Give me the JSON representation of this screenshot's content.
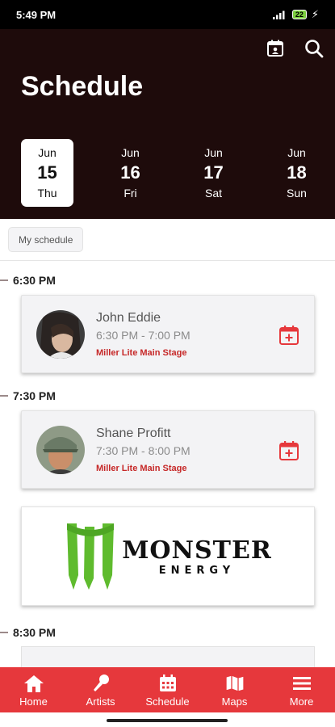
{
  "status": {
    "time": "5:49 PM",
    "battery": "22"
  },
  "header": {
    "title": "Schedule"
  },
  "days": [
    {
      "month": "Jun",
      "day": "15",
      "weekday": "Thu"
    },
    {
      "month": "Jun",
      "day": "16",
      "weekday": "Fri"
    },
    {
      "month": "Jun",
      "day": "17",
      "weekday": "Sat"
    },
    {
      "month": "Jun",
      "day": "18",
      "weekday": "Sun"
    }
  ],
  "filter": {
    "chip": "My schedule"
  },
  "times": [
    "6:30 PM",
    "7:30 PM",
    "8:30 PM"
  ],
  "events": [
    {
      "name": "John Eddie",
      "time": "6:30 PM - 7:00 PM",
      "stage": "Miller Lite Main Stage"
    },
    {
      "name": "Shane Profitt",
      "time": "7:30 PM - 8:00 PM",
      "stage": "Miller Lite Main Stage"
    }
  ],
  "ad": {
    "brand": "MONSTER",
    "sub": "ENERGY"
  },
  "nav": [
    {
      "label": "Home",
      "icon": "home-icon"
    },
    {
      "label": "Artists",
      "icon": "microphone-icon"
    },
    {
      "label": "Schedule",
      "icon": "calendar-icon"
    },
    {
      "label": "Maps",
      "icon": "map-icon"
    },
    {
      "label": "More",
      "icon": "menu-icon"
    }
  ],
  "colors": {
    "header": "#1e0b0b",
    "accent": "#e6383c",
    "stage": "#c62828"
  }
}
